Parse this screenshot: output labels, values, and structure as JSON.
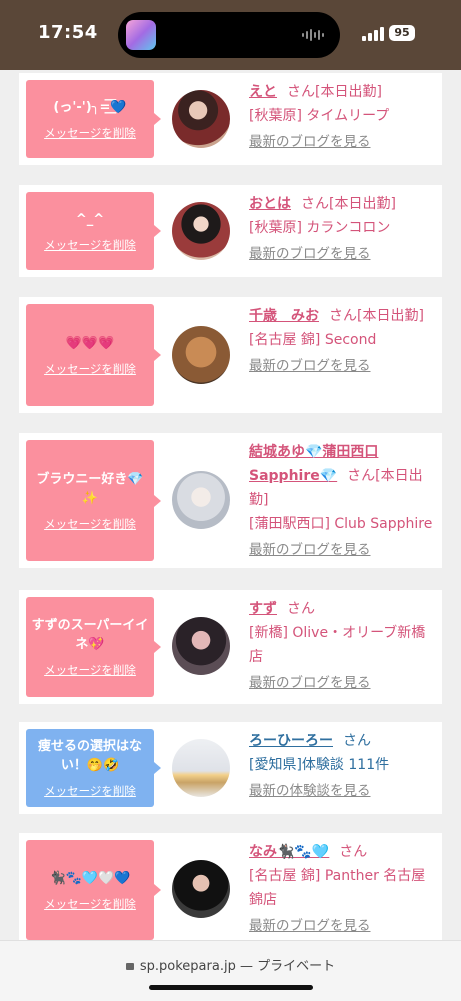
{
  "status": {
    "time": "17:54",
    "battery": "95"
  },
  "entries": [
    {
      "message": "(っ'-')╮=͟͟͞͞💙",
      "delete_label": "メッセージを削除",
      "name": "えと",
      "suffix": "さん[本日出勤]",
      "shop": "[秋葉原] タイムリープ",
      "link": "最新のブログを見る",
      "color": "#fb909e"
    },
    {
      "message": "^_^",
      "delete_label": "メッセージを削除",
      "name": "おとは",
      "suffix": "さん[本日出勤]",
      "shop": "[秋葉原] カランコロン",
      "link": "最新のブログを見る",
      "color": "#fb909e"
    },
    {
      "message": "💗💗💗",
      "delete_label": "メッセージを削除",
      "name": "千歳　みお",
      "suffix": "さん[本日出勤]",
      "shop": "[名古屋 錦] Second",
      "link": "最新のブログを見る",
      "color": "#fb909e"
    },
    {
      "message": "ブラウニー好き💎✨",
      "delete_label": "メッセージを削除",
      "name": "結城あゆ💎蒲田西口Sapphire💎",
      "suffix": "さん[本日出勤]",
      "shop": "[蒲田駅西口] Club Sapphire",
      "link": "最新のブログを見る",
      "color": "#fb909e"
    },
    {
      "message": "すずのスーパーイイネ💖",
      "delete_label": "メッセージを削除",
      "name": "すず",
      "suffix": "さん",
      "shop": "[新橋] Olive・オリーブ新橋店",
      "link": "最新のブログを見る",
      "color": "#fb909e"
    },
    {
      "message": "痩せるの選択はない！🤭🤣",
      "delete_label": "メッセージを削除",
      "name": "ろーひーろー",
      "suffix": "さん",
      "shop": "[愛知県]体験談 111件",
      "link": "最新の体験談を見る",
      "color": "#7fb2f0"
    },
    {
      "message": "🐈‍⬛🐾🩵🤍💙",
      "delete_label": "メッセージを削除",
      "name": "なみ🐈‍⬛🐾🩵",
      "suffix": "さん",
      "shop": "[名古屋 錦] Panther 名古屋錦店",
      "link": "最新のブログを見る",
      "color": "#fb909e"
    }
  ],
  "browser": {
    "url": "sp.pokepara.jp",
    "mode": "— プライベート"
  }
}
